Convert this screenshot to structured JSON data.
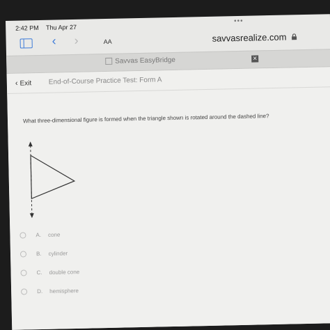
{
  "status_bar": {
    "time": "2:42 PM",
    "date": "Thu Apr 27",
    "dots": "•••"
  },
  "toolbar": {
    "back_glyph": "‹",
    "forward_glyph": "›",
    "text_size_label": "AA",
    "url": "savvasrealize.com",
    "lock_icon": "lock-icon"
  },
  "tab": {
    "title": "Savvas EasyBridge",
    "close_glyph": "✕"
  },
  "header": {
    "exit_label": "Exit",
    "test_title": "End-of-Course Practice Test: Form A"
  },
  "question": {
    "text": "What three-dimensional figure is formed when the triangle shown is rotated around the dashed line?",
    "choices": [
      {
        "letter": "A.",
        "text": "cone"
      },
      {
        "letter": "B.",
        "text": "cylinder"
      },
      {
        "letter": "C.",
        "text": "double cone"
      },
      {
        "letter": "D.",
        "text": "hemisphere"
      }
    ]
  },
  "colors": {
    "accent": "#3d7bd9",
    "page_bg": "#f0f0ee",
    "frame_bg": "#1c1c1c"
  }
}
